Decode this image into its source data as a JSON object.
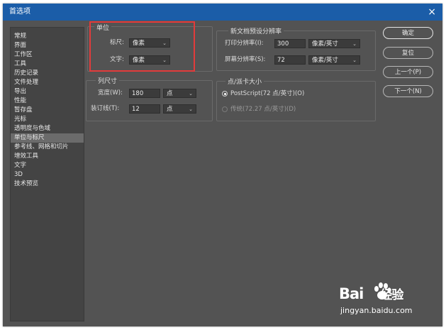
{
  "window": {
    "title": "首选项",
    "close_glyph": "×"
  },
  "sidebar": {
    "selected_index": 13,
    "items": [
      "常规",
      "界面",
      "工作区",
      "工具",
      "历史记录",
      "文件处理",
      "导出",
      "性能",
      "暂存盘",
      "光标",
      "透明度与色域",
      "单位与标尺",
      "参考线、网格和切片",
      "增效工具",
      "文字",
      "3D",
      "技术预览"
    ]
  },
  "units": {
    "title": "单位",
    "ruler_label": "标尺:",
    "ruler_value": "像素",
    "type_label": "文字:",
    "type_value": "像素"
  },
  "columns": {
    "title": "列尺寸",
    "width_label": "宽度(W):",
    "width_value": "180",
    "width_unit": "点",
    "gutter_label": "装订线(T):",
    "gutter_value": "12",
    "gutter_unit": "点"
  },
  "preset": {
    "title": "新文档预设分辨率",
    "print_label": "打印分辨率(I):",
    "print_value": "300",
    "print_unit": "像素/英寸",
    "screen_label": "屏幕分辨率(S):",
    "screen_value": "72",
    "screen_unit": "像素/英寸"
  },
  "point_size": {
    "title": "点/派卡大小",
    "postscript_label": "PostScript(72 点/英寸)(O)",
    "traditional_label": "传统(72.27 点/英寸)(D)"
  },
  "buttons": {
    "ok": "确定",
    "reset": "复位",
    "prev": "上一个(P)",
    "next": "下一个(N)"
  },
  "watermark": {
    "brand": "Bai",
    "brand2": "经验",
    "url": "jingyan.baidu.com"
  },
  "colors": {
    "titlebar": "#1b5da8",
    "panel": "#535353",
    "highlight": "#e23b3b"
  }
}
